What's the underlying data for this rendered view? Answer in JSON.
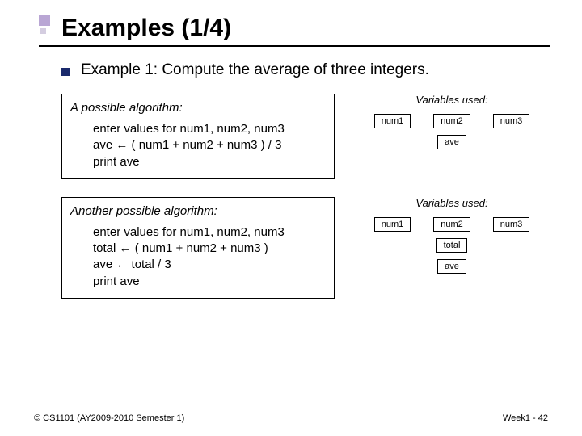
{
  "title": "Examples (1/4)",
  "bullet": "Example 1: Compute the average of three integers.",
  "algo1": {
    "title": "A possible algorithm:",
    "line1": "enter values for num1, num2, num3",
    "line2_a": "ave ",
    "line2_arrow": "←",
    "line2_b": " ( num1 + num2 + num3 ) / 3",
    "line3": "print ave"
  },
  "algo2": {
    "title": "Another possible algorithm:",
    "line1": "enter values for num1, num2, num3",
    "line2_a": "total ",
    "line2_arrow": "←",
    "line2_b": " ( num1 + num2 + num3 )",
    "line3_a": "ave ",
    "line3_arrow": "←",
    "line3_b": " total  / 3",
    "line4": "print ave"
  },
  "vars1": {
    "title": "Variables used:",
    "b1": "num1",
    "b2": "num2",
    "b3": "num3",
    "b4": "ave"
  },
  "vars2": {
    "title": "Variables used:",
    "b1": "num1",
    "b2": "num2",
    "b3": "num3",
    "b4": "total",
    "b5": "ave"
  },
  "footer_left": "© CS1101 (AY2009-2010 Semester 1)",
  "footer_right": "Week1 - 42"
}
